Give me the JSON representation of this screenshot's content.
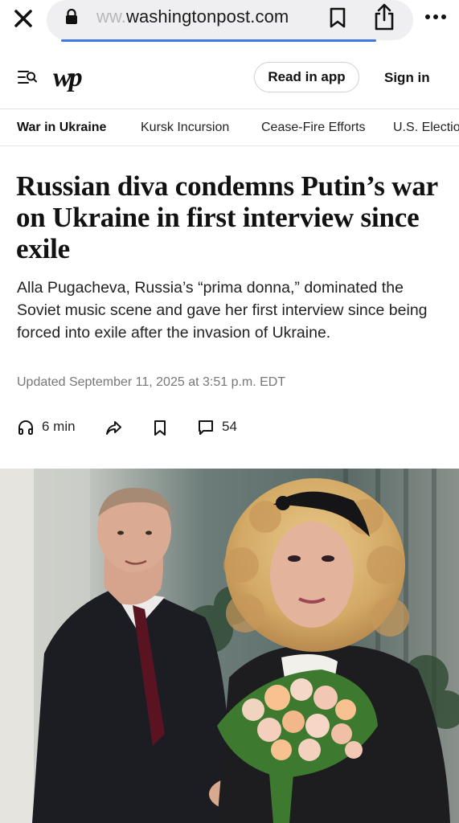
{
  "browser": {
    "url_faded": "ww.",
    "url_main": "washingtonpost.com",
    "icons": [
      "close-icon",
      "lock-icon",
      "bookmark-icon",
      "share-icon",
      "more-icon"
    ]
  },
  "header": {
    "logo": "wp",
    "read_in_app": "Read in app",
    "sign_in": "Sign in",
    "icons": [
      "menu-search-icon"
    ]
  },
  "topics": [
    "War in Ukraine",
    "Kursk Incursion",
    "Cease-Fire Efforts",
    "U.S. Elections"
  ],
  "article": {
    "headline": "Russian diva condemns Putin’s war on Ukraine in first interview since exile",
    "dek": "Alla Pugacheva, Russia’s “prima donna,” dominated the Soviet music scene and gave her first interview since being forced into exile after the invasion of Ukraine.",
    "timestamp": "Updated September 11, 2025 at 3:51 p.m. EDT",
    "listen_time": "6 min",
    "comment_count": "54",
    "action_icons": [
      "headphones-icon",
      "share-icon",
      "bookmark-icon",
      "comment-icon"
    ]
  },
  "colors": {
    "progress": "#3f78e3",
    "pill": "#efeff1",
    "muted": "#777777"
  }
}
